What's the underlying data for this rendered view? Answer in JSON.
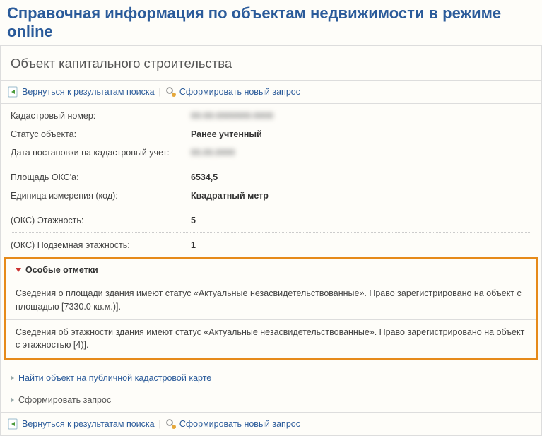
{
  "page": {
    "title": "Справочная информация по объектам недвижимости в режиме online",
    "subtitle": "Объект капитального строительства"
  },
  "toolbar": {
    "back_label": "Вернуться к результатам поиска",
    "new_query_label": "Сформировать новый запрос",
    "separator": "|"
  },
  "fields": {
    "cadastral": {
      "label": "Кадастровый номер:",
      "value": "00:00:0000000:0000"
    },
    "status": {
      "label": "Статус объекта:",
      "value": "Ранее учтенный"
    },
    "reg_date": {
      "label": "Дата постановки на кадастровый учет:",
      "value": "00.00.0000"
    },
    "area": {
      "label": "Площадь ОКС'а:",
      "value": "6534,5"
    },
    "unit": {
      "label": "Единица измерения (код):",
      "value": "Квадратный метр"
    },
    "floors": {
      "label": "(ОКС) Этажность:",
      "value": "5"
    },
    "underground": {
      "label": "(ОКС) Подземная этажность:",
      "value": "1"
    }
  },
  "remarks": {
    "header": "Особые отметки",
    "items": [
      "Сведения о площади здания имеют статус «Актуальные незасвидетельствованные». Право зарегистрировано на объект с площадью [7330.0 кв.м.)].",
      "Сведения об этажности здания имеют статус «Актуальные незасвидетельствованные». Право зарегистрировано на объект с этажностью [4)]."
    ]
  },
  "links": {
    "map": "Найти объект на публичной кадастровой карте",
    "query": "Сформировать запрос"
  }
}
